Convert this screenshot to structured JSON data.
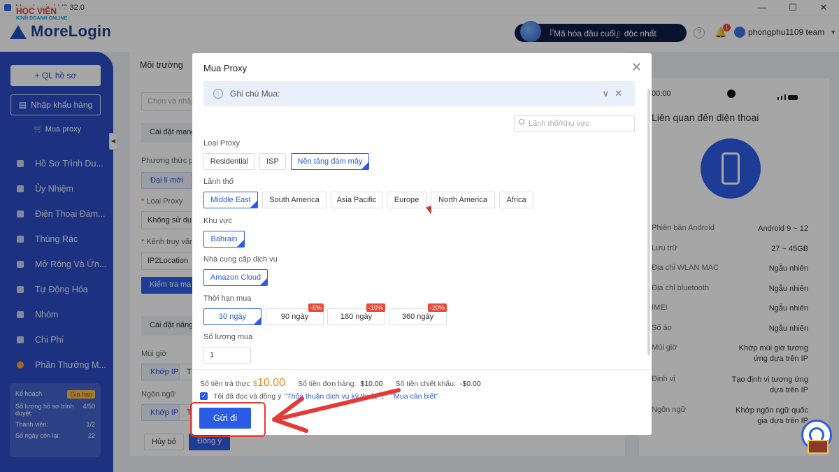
{
  "window": {
    "title": "MoreLogin | V2.32.0",
    "minimize": "—",
    "maximize": "☐",
    "close": "✕"
  },
  "watermark": {
    "line1": "HỌC VIỆN",
    "line2": "KINH DOANH ONLINE"
  },
  "header": {
    "logo": "MoreLogin",
    "promo": "『Mã hóa đầu cuối』độc nhất",
    "help": "?",
    "bell_badge": "1",
    "user": "phongphu1109 team"
  },
  "sidebar": {
    "add_profile": "+ QL hồ sơ",
    "import": "Nhập khẩu hàng",
    "buy_proxy": "Mua proxy",
    "items": [
      "Hồ Sơ Trình Du...",
      "Ủy Nhiệm",
      "Điện Thoại Đám...",
      "Thùng Rác",
      "Mở Rộng Và Ứn...",
      "Tự Động Hóa",
      "Nhóm",
      "Chi Phí",
      "Phần Thưởng M..."
    ],
    "plan": {
      "label": "Kế hoạch",
      "renew": "Gia hạn",
      "profiles_label": "Số lượng hồ sơ trình duyệt:",
      "profiles_value": "4/50",
      "members_label": "Thành viên:",
      "members_value": "1/2",
      "days_label": "Số ngày còn lại:",
      "days_value": "22"
    }
  },
  "background": {
    "title": "Môi trường",
    "select_placeholder": "Chọn và nhập",
    "network_section": "Cài đặt mạng",
    "method_label": "Phương thức p",
    "agent_new": "Đại lí mới",
    "proxy_type_label": "Loại Proxy",
    "proxy_type_value": "Không sử dụ",
    "channel_label": "Kênh truy vấn",
    "channel_value": "IP2Location",
    "check_btn": "Kiểm tra mạ",
    "advanced_section": "Cài đặt nâng",
    "timezone_label": "Múi giờ",
    "timezone_btn": "Khớp IP",
    "timezone_btn2": "T",
    "lang_label": "Ngôn ngữ",
    "lang_btn": "Khớp IP",
    "lang_btn2": "T",
    "cancel": "Hủy bỏ",
    "confirm": "Đồng ý"
  },
  "phone": {
    "time": "00:00",
    "title": "Liên quan đến điện thoại",
    "rows": [
      {
        "k": "Phiên bản Android",
        "v": "Android 9 ~ 12"
      },
      {
        "k": "Lưu trữ",
        "v": "27 ~ 45GB"
      },
      {
        "k": "Địa chỉ WLAN MAC",
        "v": "Ngẫu nhiên"
      },
      {
        "k": "Địa chỉ bluetooth",
        "v": "Ngẫu nhiên"
      },
      {
        "k": "IMEI",
        "v": "Ngẫu nhiên"
      },
      {
        "k": "Số ảo",
        "v": "Ngẫu nhiên"
      },
      {
        "k": "Múi giờ",
        "v": "Khớp múi giờ tương ứng dựa trên IP"
      },
      {
        "k": "Định vị",
        "v": "Tạo định vị tương ứng dựa trên IP"
      },
      {
        "k": "Ngôn ngữ",
        "v": "Khớp ngôn ngữ quốc gia dựa trên IP"
      }
    ]
  },
  "modal": {
    "title": "Mua Proxy",
    "note": "Ghi chú Mua:",
    "search_placeholder": "Lãnh thổ/Khu vực",
    "proxy_type_label": "Loại Proxy",
    "proxy_types": [
      "Residential",
      "ISP",
      "Nền tảng đám mây"
    ],
    "territory_label": "Lãnh thổ",
    "territories": [
      "Middle East",
      "South America",
      "Asia Pacific",
      "Europe",
      "North America",
      "Africa"
    ],
    "region_label": "Khu vực",
    "region": "Bahrain",
    "provider_label": "Nhà cung cấp dịch vụ",
    "provider": "Amazon Cloud",
    "duration_label": "Thời hạn mua",
    "durations": [
      "30 ngày",
      "90 ngày",
      "180 ngày",
      "360 ngày"
    ],
    "discounts": [
      "-5%",
      "-10%",
      "-20%"
    ],
    "qty_label": "Số lượng mua",
    "qty": "1",
    "actual_label": "Số tiền trả thực",
    "actual_currency": "$",
    "actual_value": "10.00",
    "order_label": "Số tiền đơn hàng:",
    "order_value": "$10.00",
    "discount_label": "Số tiền chiết khấu:",
    "discount_value": "-$0.00",
    "agree_text": "Tôi đã đọc và đồng ý",
    "agree_link1": "\"Thỏa thuận dịch vụ kỹ thuật\"",
    "agree_link2": "\"Mua cần biết\"",
    "submit": "Gửi đi"
  },
  "colors": {
    "primary": "#2b5ce6",
    "sidebar": "#2b4ec7",
    "highlight": "#e53935",
    "price": "#f08a24"
  }
}
